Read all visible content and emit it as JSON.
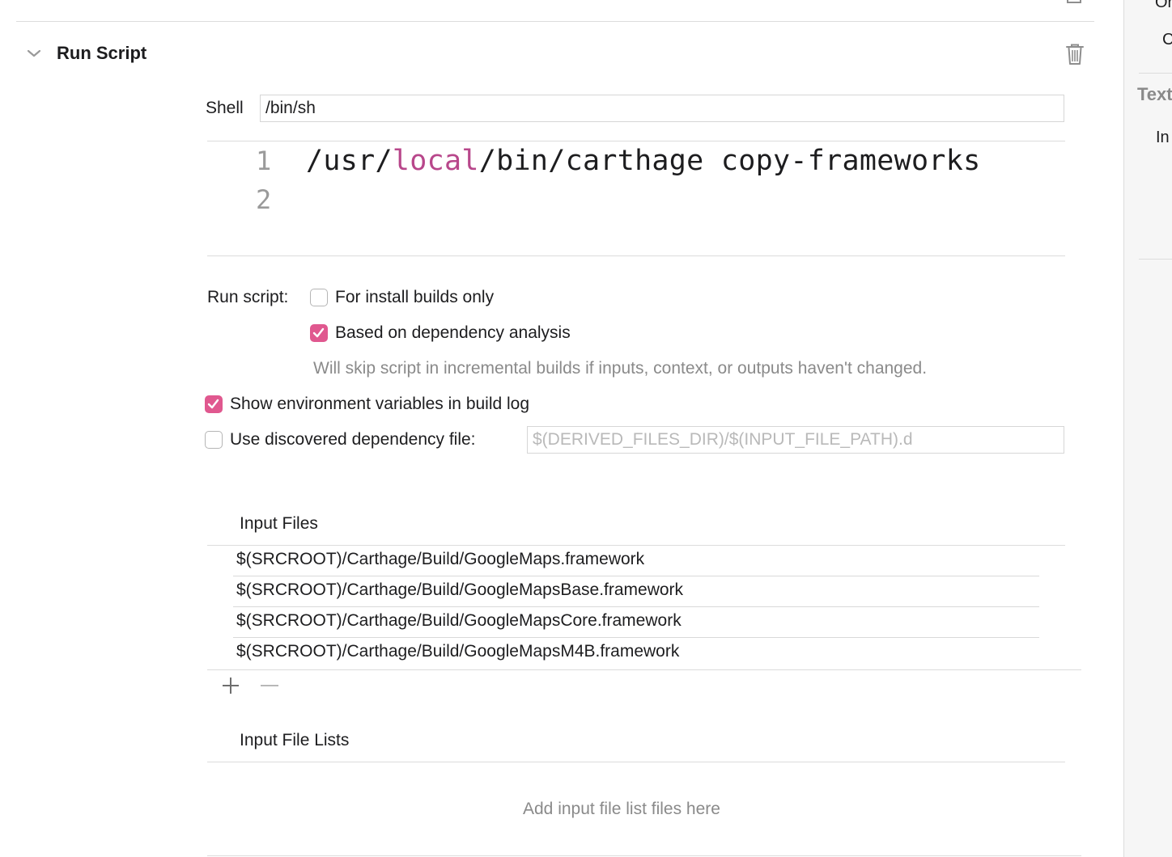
{
  "phase": {
    "title": "Run Script"
  },
  "shell": {
    "label": "Shell",
    "value": "/bin/sh"
  },
  "script": {
    "line_numbers": [
      "1",
      "2"
    ],
    "line1": {
      "part1": "/usr/",
      "keyword": "local",
      "part2": "/bin/carthage copy-frameworks"
    },
    "line2": ""
  },
  "run_script": {
    "label": "Run script:",
    "options": [
      {
        "label": "For install builds only",
        "checked": false
      },
      {
        "label": "Based on dependency analysis",
        "checked": true
      }
    ],
    "hint": "Will skip script in incremental builds if inputs, context, or outputs haven't changed."
  },
  "show_env": {
    "label": "Show environment variables in build log",
    "checked": true
  },
  "dep_file": {
    "label": "Use discovered dependency file:",
    "checked": false,
    "placeholder": "$(DERIVED_FILES_DIR)/$(INPUT_FILE_PATH).d"
  },
  "input_files": {
    "title": "Input Files",
    "items": [
      "$(SRCROOT)/Carthage/Build/GoogleMaps.framework",
      "$(SRCROOT)/Carthage/Build/GoogleMapsBase.framework",
      "$(SRCROOT)/Carthage/Build/GoogleMapsCore.framework",
      "$(SRCROOT)/Carthage/Build/GoogleMapsM4B.framework"
    ],
    "add_symbol": "+",
    "remove_symbol": "−"
  },
  "input_file_lists": {
    "title": "Input File Lists",
    "empty_hint": "Add input file list files here"
  },
  "inspector": {
    "top_text_1": "Or",
    "top_text_2": "C",
    "section_title": "Text",
    "item_1": "In"
  },
  "colors": {
    "accent": "#e0588f",
    "keyword": "#b8478b",
    "divider": "#dcdcdc"
  }
}
